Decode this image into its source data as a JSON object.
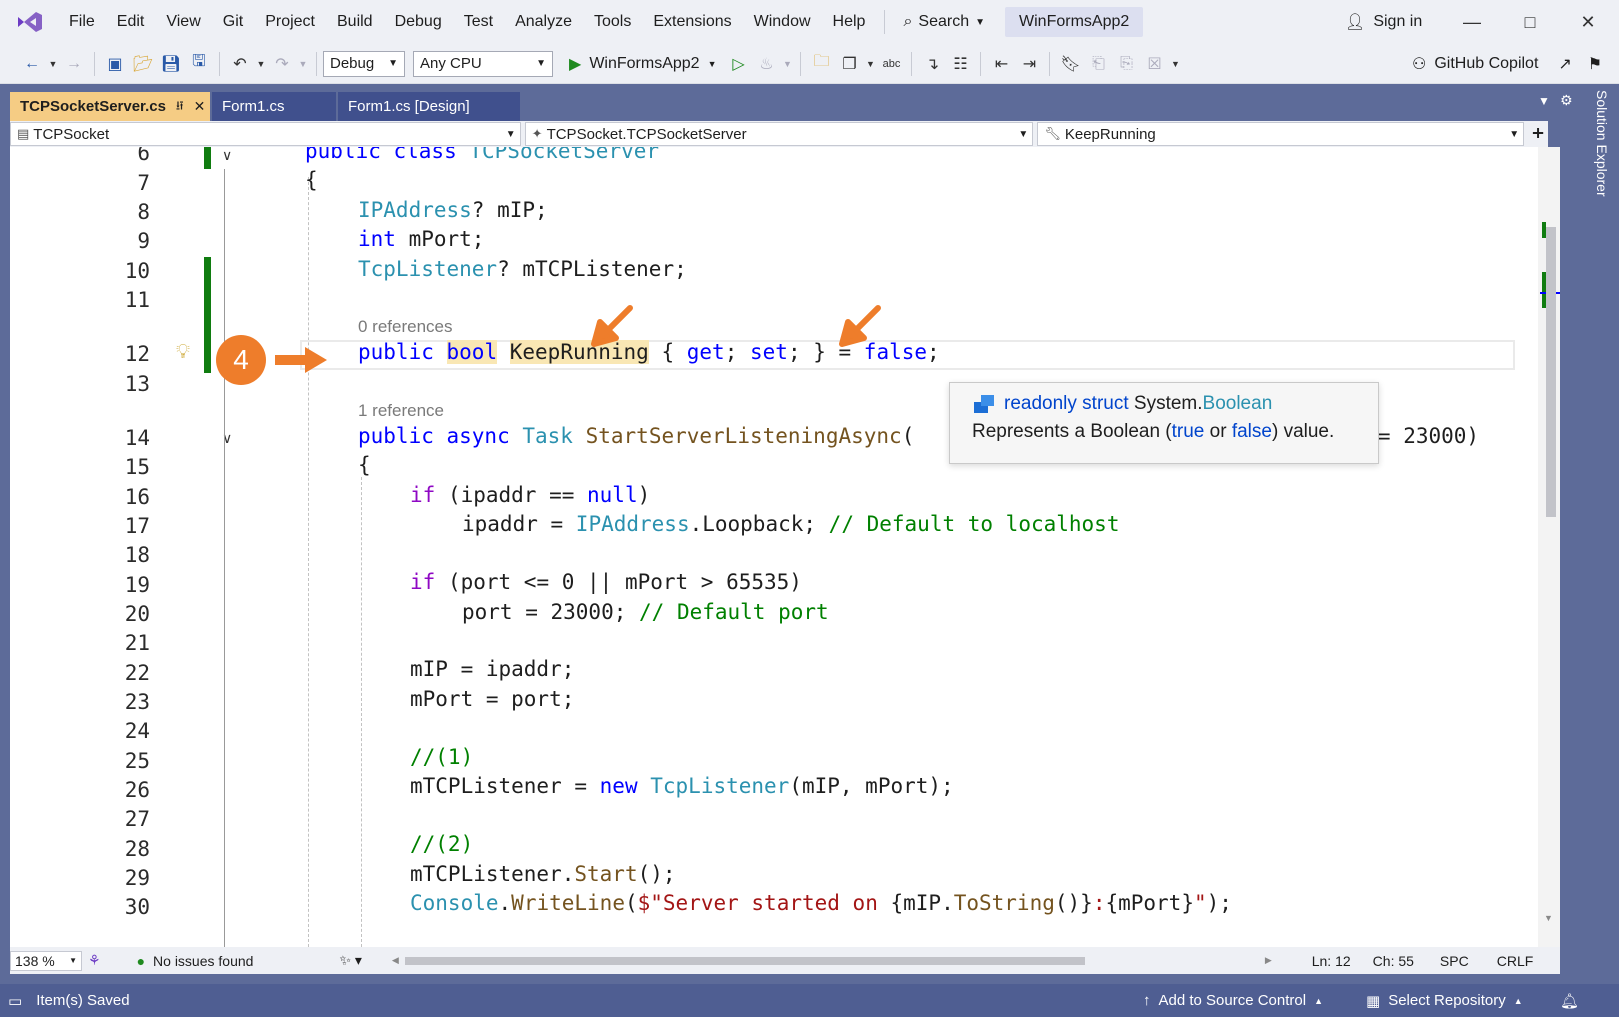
{
  "menu": {
    "items": [
      "File",
      "Edit",
      "View",
      "Git",
      "Project",
      "Build",
      "Debug",
      "Test",
      "Analyze",
      "Tools",
      "Extensions",
      "Window",
      "Help"
    ],
    "search_label": "Search",
    "solution_name": "WinFormsApp2",
    "sign_in": "Sign in"
  },
  "toolbar": {
    "config": "Debug",
    "platform": "Any CPU",
    "run_target": "WinFormsApp2",
    "copilot": "GitHub Copilot"
  },
  "tabs": [
    {
      "label": "TCPSocketServer.cs",
      "active": true
    },
    {
      "label": "Form1.cs",
      "active": false
    },
    {
      "label": "Form1.cs [Design]",
      "active": false
    }
  ],
  "navbar": {
    "project": "TCPSocket",
    "type": "TCPSocket.TCPSocketServer",
    "member": "KeepRunning"
  },
  "side_panel": "Solution Explorer",
  "code": {
    "line_numbers": [
      "6",
      "7",
      "8",
      "9",
      "10",
      "11",
      "12",
      "13",
      "14",
      "15",
      "16",
      "17",
      "18",
      "19",
      "20",
      "21",
      "22",
      "23",
      "24",
      "25",
      "26",
      "27",
      "28",
      "29",
      "30"
    ],
    "ref_hint_1": "0 references",
    "ref_hint_2": "1 reference"
  },
  "callout": {
    "step": "4",
    "accent": "#ee7d2b"
  },
  "tooltip": {
    "kind": "readonly struct",
    "ns": "System.",
    "type": "Boolean",
    "desc_pre": "Represents a Boolean (",
    "true_word": "true",
    "or_word": " or ",
    "false_word": "false",
    "desc_post": ") value."
  },
  "editor_status": {
    "zoom": "138 %",
    "issues": "No issues found",
    "ln": "Ln: 12",
    "ch": "Ch: 55",
    "spc": "SPC",
    "eol": "CRLF"
  },
  "statusbar": {
    "message": "Item(s) Saved",
    "source_control": "Add to Source Control",
    "repository": "Select Repository"
  }
}
